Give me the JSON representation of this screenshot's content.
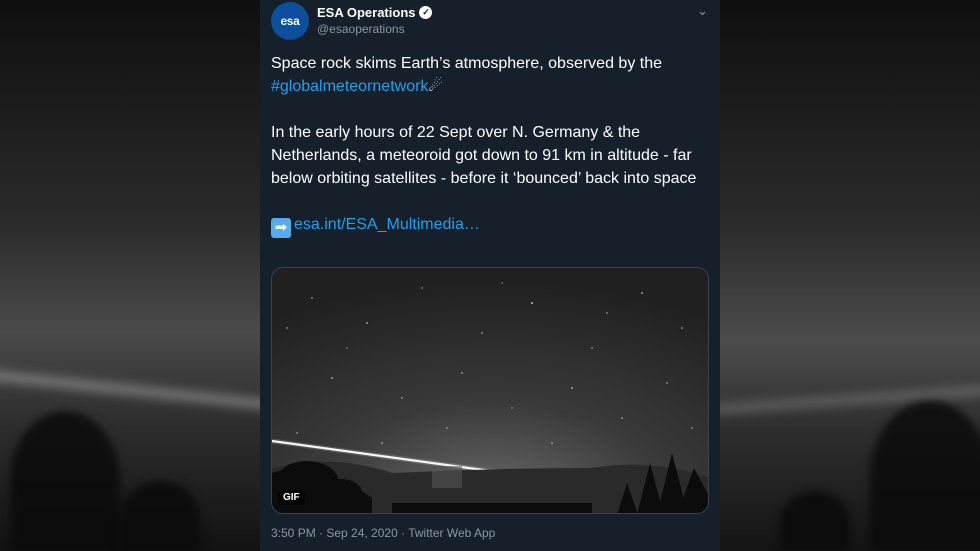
{
  "account": {
    "avatar_text": "esa",
    "name": "ESA Operations",
    "handle": "@esaoperations",
    "verified_mark": "✓"
  },
  "tweet": {
    "line1": "Space rock skims Earth’s atmosphere, observed by the",
    "hashtag": "#globalmeteornetwork",
    "hashtag_emoji": "☄",
    "body": "In the early hours of 22 Sept over N. Germany & the Netherlands, a meteoroid got down to 91 km in altitude - far below orbiting satellites - before it ‘bounced’ back into space",
    "link_emoji": "➡",
    "link": "esa.int/ESA_Multimedia…"
  },
  "media": {
    "badge": "GIF"
  },
  "meta": {
    "timestamp": "3:50 PM · Sep 24, 2020 · Twitter Web App"
  },
  "colors": {
    "card_bg": "#15202b",
    "link": "#1da1f2",
    "secondary_text": "#8899a6",
    "esa_blue": "#0b4f9e"
  },
  "icons": {
    "chevron": "chevron-down-icon",
    "verified": "verified-badge-icon",
    "arrow": "right-arrow-emoji-icon",
    "comet": "comet-emoji-icon"
  }
}
